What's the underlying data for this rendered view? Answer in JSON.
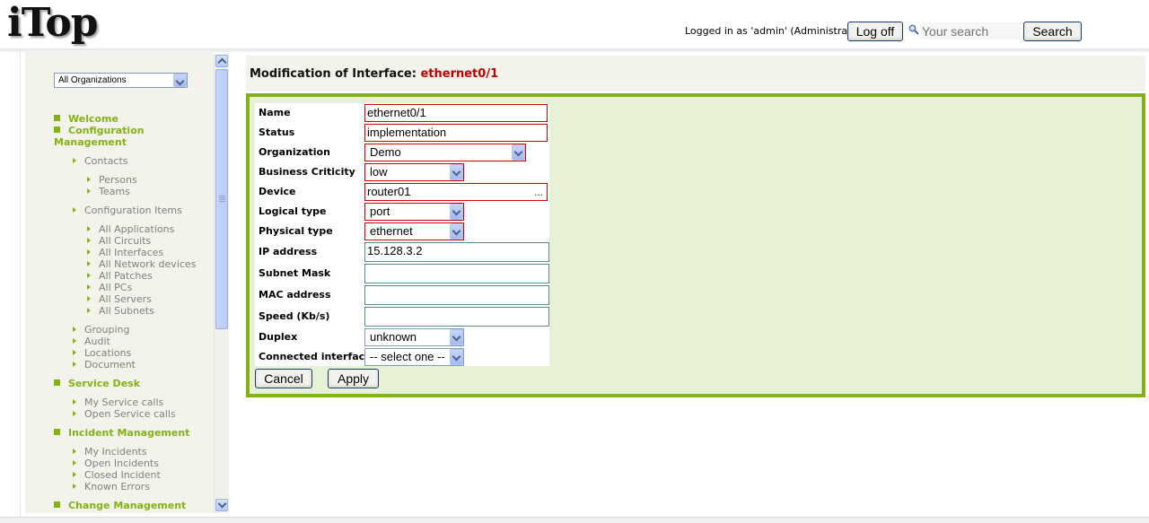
{
  "header": {
    "logo": "iTop",
    "login_text": "Logged in as 'admin' (Administrator)",
    "logoff_label": "Log off",
    "search_placeholder": "Your search",
    "search_label": "Search"
  },
  "sidebar": {
    "org_select": "All Organizations",
    "welcome": "Welcome",
    "config_mgmt_1": "Configuration",
    "config_mgmt_2": "Management",
    "contacts": "Contacts",
    "persons": "Persons",
    "teams": "Teams",
    "config_items": "Configuration Items",
    "all_applications": "All Applications",
    "all_circuits": "All Circuits",
    "all_interfaces": "All Interfaces",
    "all_network_devices": "All Network devices",
    "all_patches": "All Patches",
    "all_pcs": "All PCs",
    "all_servers": "All Servers",
    "all_subnets": "All Subnets",
    "grouping": "Grouping",
    "audit": "Audit",
    "locations": "Locations",
    "document": "Document",
    "service_desk": "Service Desk",
    "my_service_calls": "My Service calls",
    "open_service_calls": "Open Service calls",
    "incident_mgmt": "Incident Management",
    "my_incidents": "My Incidents",
    "open_incidents": "Open Incidents",
    "closed_incident": "Closed Incident",
    "known_errors": "Known Errors",
    "change_mgmt": "Change Management"
  },
  "main": {
    "title_prefix": "Modification of Interface:",
    "title_object": "ethernet0/1",
    "fields": {
      "name_label": "Name",
      "name_value": "ethernet0/1",
      "status_label": "Status",
      "status_value": "implementation",
      "org_label": "Organization",
      "org_value": "Demo",
      "crit_label": "Business Criticity",
      "crit_value": "low",
      "device_label": "Device",
      "device_value": "router01",
      "device_more": "...",
      "logical_label": "Logical type",
      "logical_value": "port",
      "physical_label": "Physical type",
      "physical_value": "ethernet",
      "ip_label": "IP address",
      "ip_value": "15.128.3.2",
      "mask_label": "Subnet Mask",
      "mask_value": "",
      "mac_label": "MAC address",
      "mac_value": "",
      "speed_label": "Speed (Kb/s)",
      "speed_value": "",
      "duplex_label": "Duplex",
      "duplex_value": "unknown",
      "connected_label": "Connected interface",
      "connected_value": "-- select one --"
    },
    "cancel_label": "Cancel",
    "apply_label": "Apply"
  },
  "colors": {
    "accent_green": "#83b217",
    "form_bg": "#e6f1d6",
    "title_object_red": "#c00000",
    "required_border": "#cc0000"
  }
}
